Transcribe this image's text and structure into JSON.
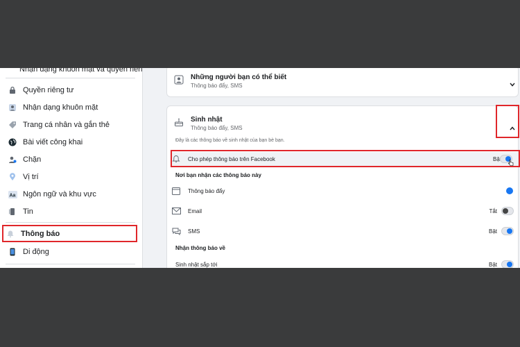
{
  "sidebar": {
    "cut_off_label": "Nhận dạng khuôn mặt và quyền riêng tư",
    "items": [
      {
        "label": "Quyền riêng tư",
        "icon": "lock-icon"
      },
      {
        "label": "Nhận dạng khuôn mặt",
        "icon": "face-recognition-icon"
      },
      {
        "label": "Trang cá nhân và gắn thẻ",
        "icon": "tag-icon"
      },
      {
        "label": "Bài viết công khai",
        "icon": "globe-icon"
      },
      {
        "label": "Chặn",
        "icon": "block-user-icon"
      },
      {
        "label": "Vị trí",
        "icon": "location-pin-icon"
      },
      {
        "label": "Ngôn ngữ và khu vực",
        "icon": "language-icon"
      },
      {
        "label": "Tin",
        "icon": "stories-icon"
      },
      {
        "label": "Thông báo",
        "icon": "bell-icon",
        "active": true
      },
      {
        "label": "Di động",
        "icon": "mobile-icon"
      }
    ]
  },
  "main": {
    "friends_card": {
      "title": "Những người bạn có thể biết",
      "subtitle": "Thông báo đẩy, SMS"
    },
    "birthday_card": {
      "title": "Sinh nhật",
      "subtitle": "Thông báo đẩy, SMS",
      "description": "Đây là các thông báo về sinh nhật của bạn bè bạn.",
      "allow_row": {
        "label": "Cho phép thông báo trên Facebook",
        "status": "Bật"
      },
      "where_heading": "Nơi bạn nhận các thông báo này",
      "channels": [
        {
          "label": "Thông báo đẩy",
          "status": "",
          "on": true,
          "icon": "push-notification-icon"
        },
        {
          "label": "Email",
          "status": "Tắt",
          "on": false,
          "icon": "email-icon"
        },
        {
          "label": "SMS",
          "status": "Bật",
          "on": true,
          "icon": "sms-icon"
        }
      ],
      "receive_heading": "Nhận thông báo về",
      "topics": [
        {
          "label": "Sinh nhật sắp tới",
          "status": "Bật",
          "on": true
        }
      ]
    }
  },
  "colors": {
    "highlight_red": "#e0262a",
    "toggle_blue": "#1877f2"
  }
}
